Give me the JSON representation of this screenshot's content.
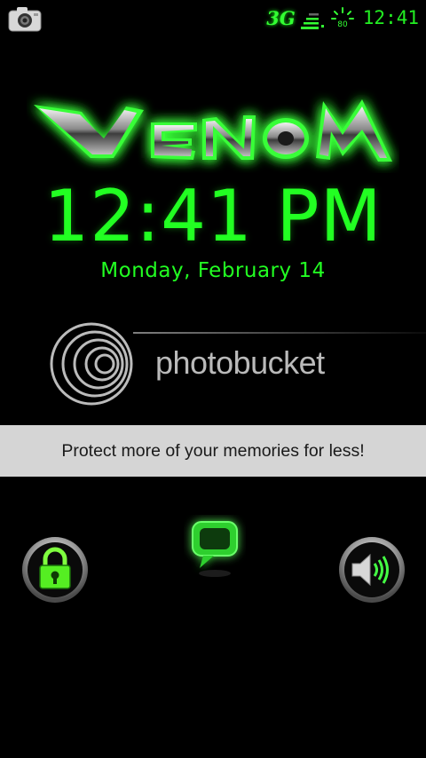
{
  "status_bar": {
    "network_type": "3G",
    "time": "12:41",
    "icons": [
      "camera-icon",
      "signal-bars-icon",
      "battery-icon"
    ],
    "battery_level_text": "80"
  },
  "lockscreen": {
    "logo_text": "VENOM",
    "time": "12:41 PM",
    "date": "Monday, February 14",
    "accent_color": "#22ff22"
  },
  "watermark": {
    "brand": "photobucket",
    "banner": "Protect more of your memories for less!"
  },
  "controls": {
    "left": "lock-icon",
    "center": "message-icon",
    "right": "speaker-icon"
  }
}
